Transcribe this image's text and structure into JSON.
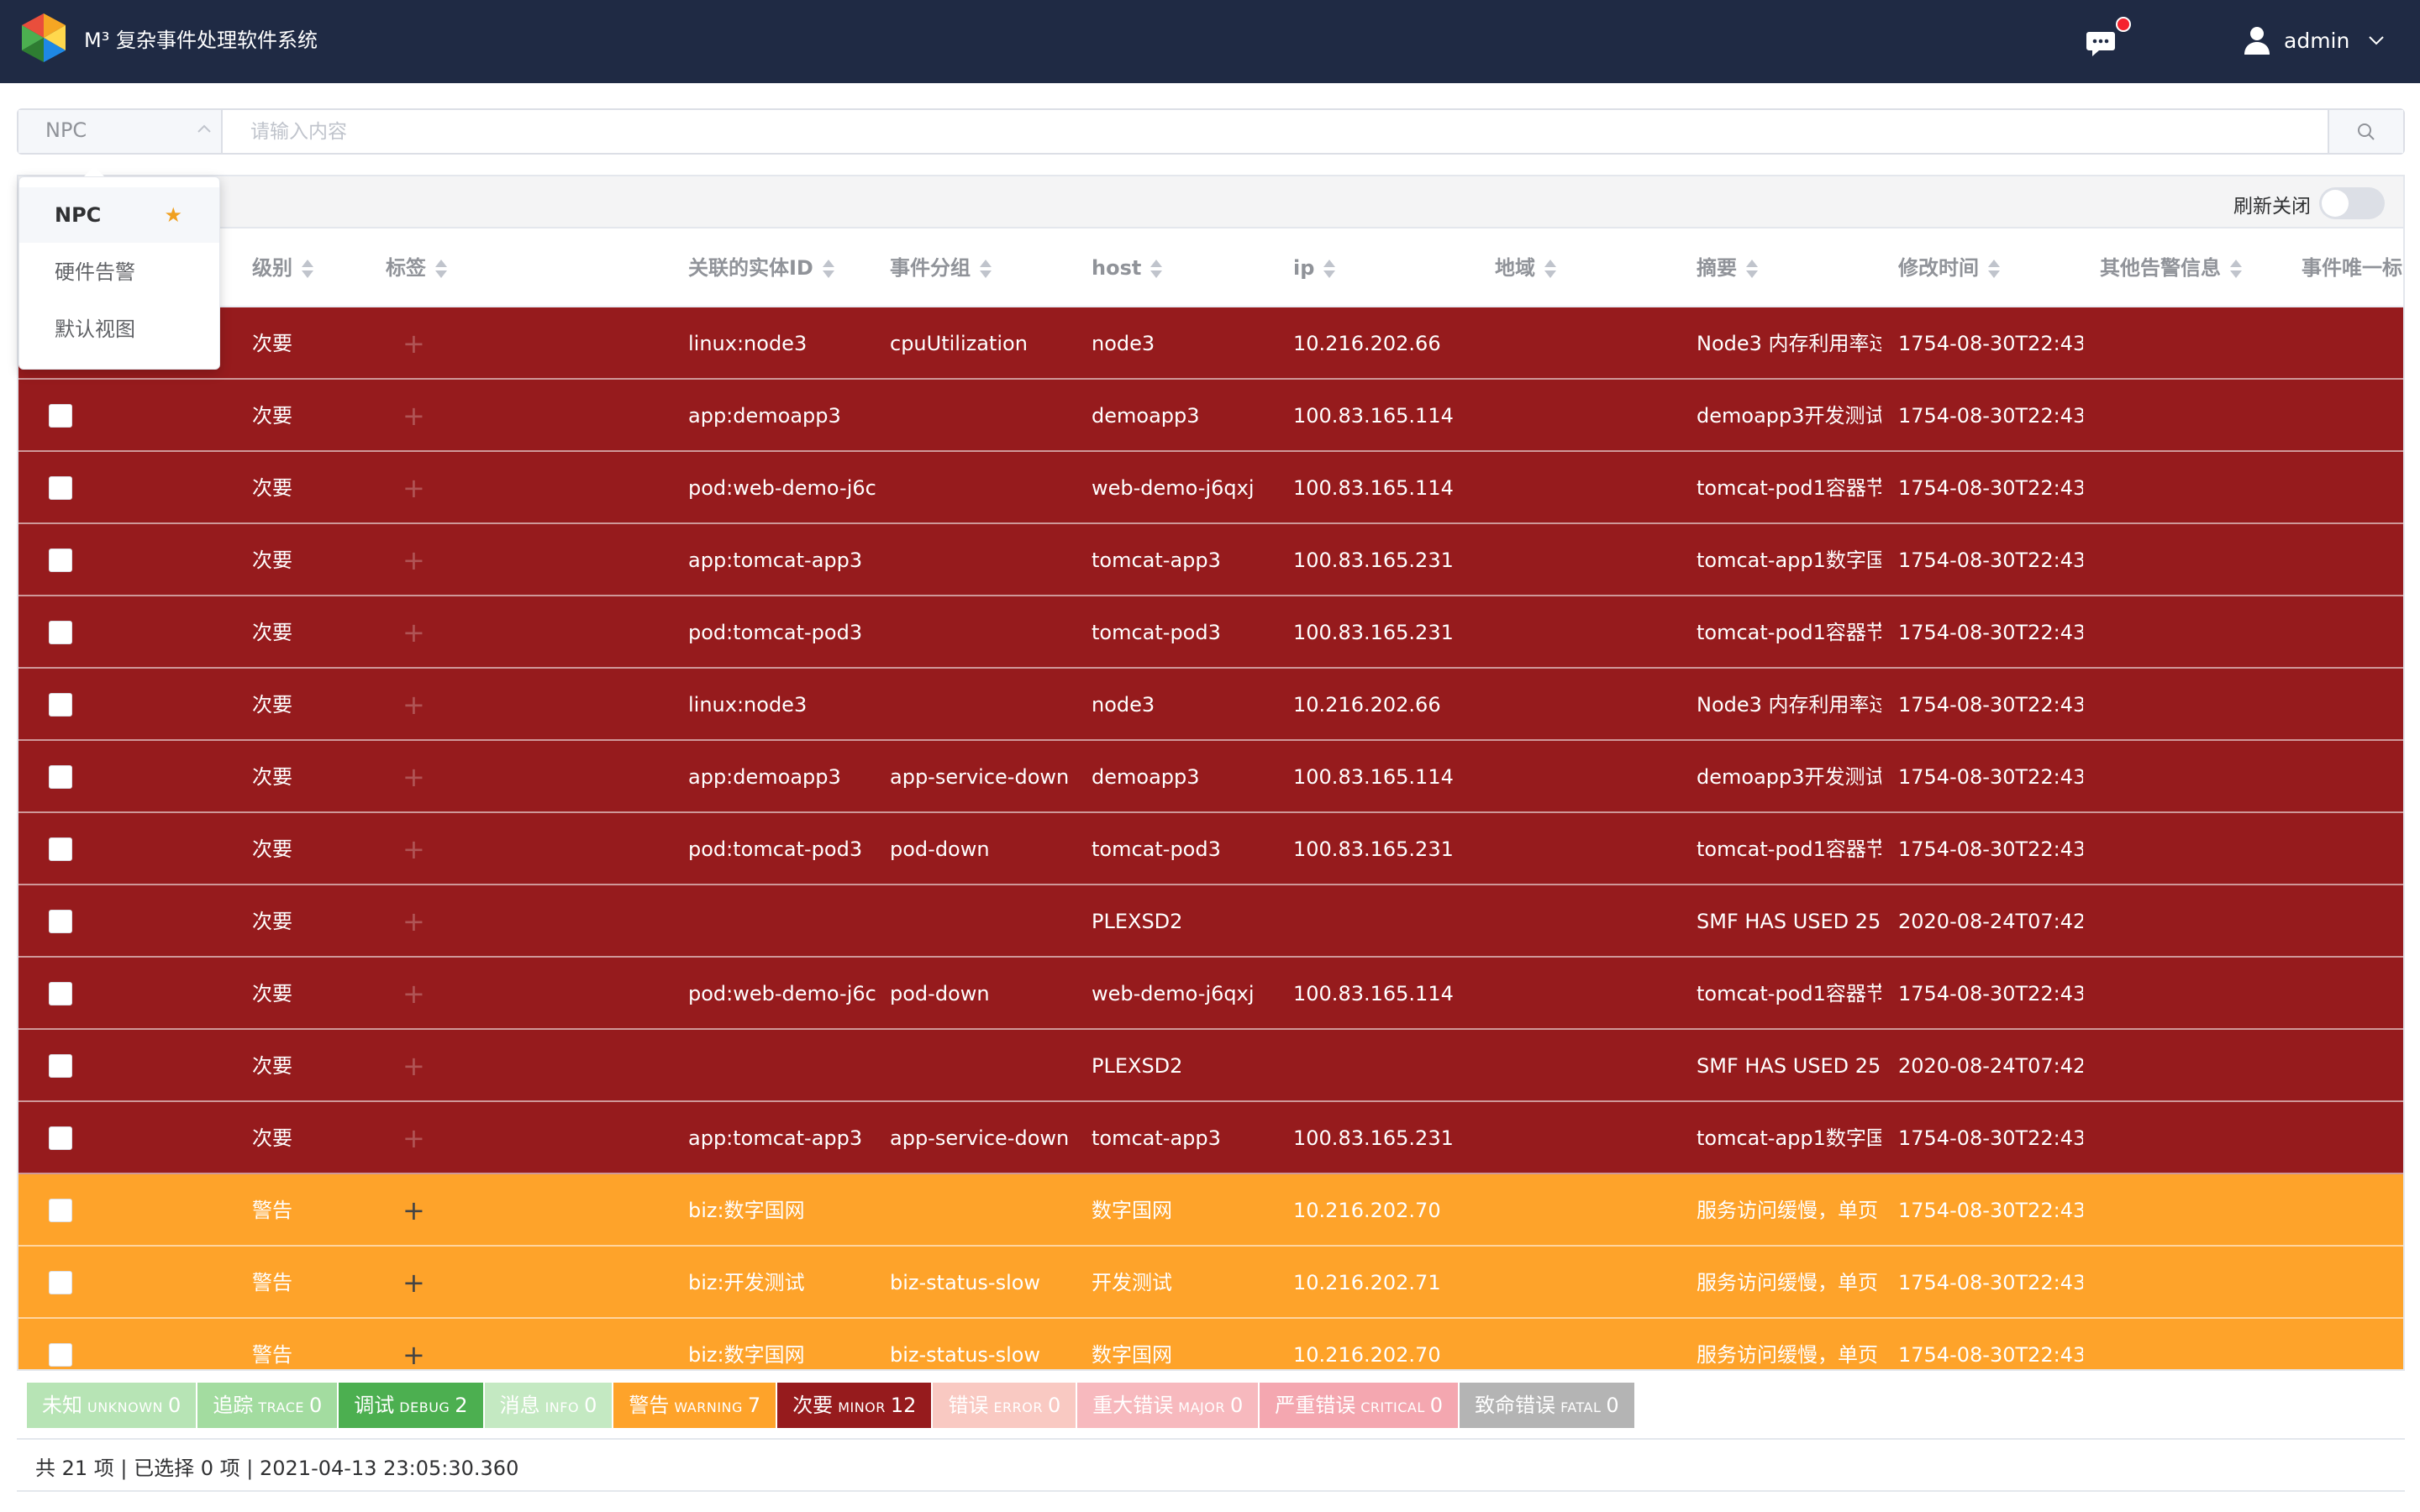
{
  "app": {
    "title": "M³ 复杂事件处理软件系统",
    "user": "admin"
  },
  "search": {
    "view_selected": "NPC",
    "placeholder": "请输入内容"
  },
  "view_dropdown": {
    "items": [
      "NPC",
      "硬件告警",
      "默认视图"
    ],
    "favorite": "NPC"
  },
  "toolbar": {
    "refresh_label": "刷新关闭",
    "refresh_on": false
  },
  "table": {
    "columns": [
      "级别",
      "标签",
      "关联的实体ID",
      "事件分组",
      "host",
      "ip",
      "地域",
      "摘要",
      "修改时间",
      "其他告警信息",
      "事件唯一标"
    ],
    "rows": [
      {
        "level": "次要",
        "entity": "linux:node3",
        "group": "cpuUtilization",
        "host": "node3",
        "ip": "10.216.202.66",
        "region": "",
        "summary": "Node3 内存利用率过",
        "time": "1754-08-30T22:43"
      },
      {
        "level": "次要",
        "entity": "app:demoapp3",
        "group": "",
        "host": "demoapp3",
        "ip": "100.83.165.114",
        "region": "",
        "summary": "demoapp3开发测试",
        "time": "1754-08-30T22:43"
      },
      {
        "level": "次要",
        "entity": "pod:web-demo-j6c",
        "group": "",
        "host": "web-demo-j6qxj",
        "ip": "100.83.165.114",
        "region": "",
        "summary": "tomcat-pod1容器节",
        "time": "1754-08-30T22:43"
      },
      {
        "level": "次要",
        "entity": "app:tomcat-app3",
        "group": "",
        "host": "tomcat-app3",
        "ip": "100.83.165.231",
        "region": "",
        "summary": "tomcat-app1数字国",
        "time": "1754-08-30T22:43"
      },
      {
        "level": "次要",
        "entity": "pod:tomcat-pod3",
        "group": "",
        "host": "tomcat-pod3",
        "ip": "100.83.165.231",
        "region": "",
        "summary": "tomcat-pod1容器节",
        "time": "1754-08-30T22:43"
      },
      {
        "level": "次要",
        "entity": "linux:node3",
        "group": "",
        "host": "node3",
        "ip": "10.216.202.66",
        "region": "",
        "summary": "Node3 内存利用率过",
        "time": "1754-08-30T22:43"
      },
      {
        "level": "次要",
        "entity": "app:demoapp3",
        "group": "app-service-down",
        "host": "demoapp3",
        "ip": "100.83.165.114",
        "region": "",
        "summary": "demoapp3开发测试",
        "time": "1754-08-30T22:43"
      },
      {
        "level": "次要",
        "entity": "pod:tomcat-pod3",
        "group": "pod-down",
        "host": "tomcat-pod3",
        "ip": "100.83.165.231",
        "region": "",
        "summary": "tomcat-pod1容器节",
        "time": "1754-08-30T22:43"
      },
      {
        "level": "次要",
        "entity": "",
        "group": "",
        "host": "PLEXSD2",
        "ip": "",
        "region": "",
        "summary": "SMF HAS USED 25",
        "time": "2020-08-24T07:42"
      },
      {
        "level": "次要",
        "entity": "pod:web-demo-j6c",
        "group": "pod-down",
        "host": "web-demo-j6qxj",
        "ip": "100.83.165.114",
        "region": "",
        "summary": "tomcat-pod1容器节",
        "time": "1754-08-30T22:43"
      },
      {
        "level": "次要",
        "entity": "",
        "group": "",
        "host": "PLEXSD2",
        "ip": "",
        "region": "",
        "summary": "SMF HAS USED 25",
        "time": "2020-08-24T07:42"
      },
      {
        "level": "次要",
        "entity": "app:tomcat-app3",
        "group": "app-service-down",
        "host": "tomcat-app3",
        "ip": "100.83.165.231",
        "region": "",
        "summary": "tomcat-app1数字国",
        "time": "1754-08-30T22:43"
      },
      {
        "level": "警告",
        "entity": "biz:数字国网",
        "group": "",
        "host": "数字国网",
        "ip": "10.216.202.70",
        "region": "",
        "summary": "服务访问缓慢，单页",
        "time": "1754-08-30T22:43"
      },
      {
        "level": "警告",
        "entity": "biz:开发测试",
        "group": "biz-status-slow",
        "host": "开发测试",
        "ip": "10.216.202.71",
        "region": "",
        "summary": "服务访问缓慢，单页",
        "time": "1754-08-30T22:43"
      },
      {
        "level": "警告",
        "entity": "biz:数字国网",
        "group": "biz-status-slow",
        "host": "数字国网",
        "ip": "10.216.202.70",
        "region": "",
        "summary": "服务访问缓慢，单页",
        "time": "1754-08-30T22:43"
      }
    ]
  },
  "severity_legend": [
    {
      "cn": "未知",
      "en": "UNKNOWN",
      "count": "0",
      "color": "#b7e4b5"
    },
    {
      "cn": "追踪",
      "en": "TRACE",
      "count": "0",
      "color": "#a3dca0"
    },
    {
      "cn": "调试",
      "en": "DEBUG",
      "count": "2",
      "color": "#4caf50"
    },
    {
      "cn": "消息",
      "en": "INFO",
      "count": "0",
      "color": "#c4e9c2"
    },
    {
      "cn": "警告",
      "en": "WARNING",
      "count": "7",
      "color": "#fea32a"
    },
    {
      "cn": "次要",
      "en": "MINOR",
      "count": "12",
      "color": "#961b1d"
    },
    {
      "cn": "错误",
      "en": "ERROR",
      "count": "0",
      "color": "#f9c9c2"
    },
    {
      "cn": "重大错误",
      "en": "MAJOR",
      "count": "0",
      "color": "#f7b9be"
    },
    {
      "cn": "严重错误",
      "en": "CRITICAL",
      "count": "0",
      "color": "#f4a7b0"
    },
    {
      "cn": "致命错误",
      "en": "FATAL",
      "count": "0",
      "color": "#b4b4b4"
    }
  ],
  "status": {
    "text": "共 21 项 | 已选择 0 项 | 2021-04-13 23:05:30.360"
  }
}
